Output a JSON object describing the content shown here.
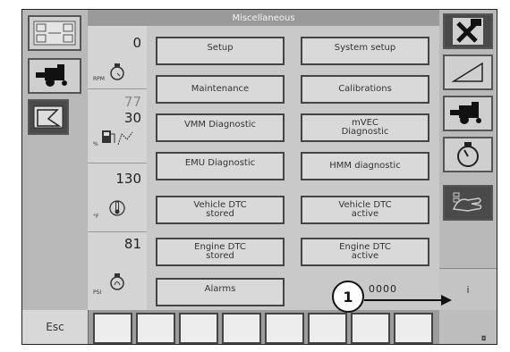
{
  "header": {
    "title": "Miscellaneous"
  },
  "gauges": [
    {
      "value": "0",
      "unit": "RPM",
      "icon": "engine-speed-icon"
    },
    {
      "value_dim": "77",
      "value": "30",
      "unit": "%",
      "icon": "fuel-gauge-icon"
    },
    {
      "value": "130",
      "unit": "°F",
      "icon": "temperature-icon"
    },
    {
      "value": "81",
      "unit": "PSI",
      "icon": "oil-pressure-icon"
    }
  ],
  "menu": [
    {
      "label": "Setup"
    },
    {
      "label": "System setup"
    },
    {
      "label": "Maintenance"
    },
    {
      "label": "Calibrations"
    },
    {
      "label": "VMM Diagnostic"
    },
    {
      "label": "mVEC\nDiagnostic"
    },
    {
      "label": "EMU Diagnostic"
    },
    {
      "label": "HMM diagnostic"
    },
    {
      "label": "Vehicle DTC\nstored"
    },
    {
      "label": "Vehicle DTC\nactive"
    },
    {
      "label": "Engine DTC\nstored"
    },
    {
      "label": "Engine DTC\nactive"
    },
    {
      "label": "Alarms"
    }
  ],
  "footer": {
    "esc_label": "Esc",
    "info_label": "i",
    "corner_mark": "◘"
  },
  "callout": {
    "number": "1",
    "obscured_text": "0000"
  },
  "icons": {
    "left": [
      "grid-settings-icon",
      "combine-harvester-icon",
      "field-boundary-icon"
    ],
    "right": [
      "tools-icon",
      "slope-icon",
      "combine-harvester-icon",
      "engine-speed-icon",
      "operator-hand-icon"
    ]
  }
}
